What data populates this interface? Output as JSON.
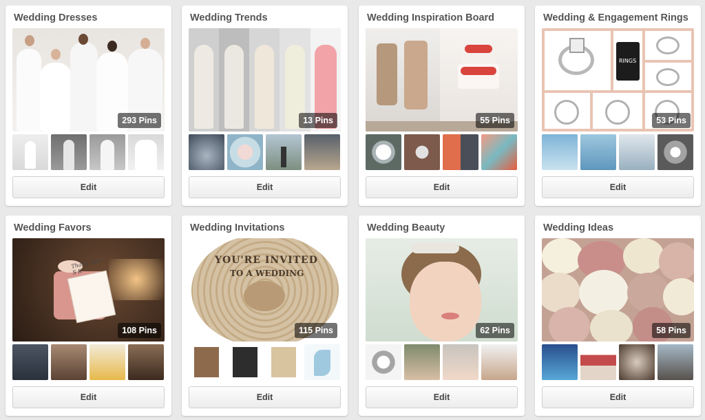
{
  "boards": [
    {
      "title": "Wedding Dresses",
      "pin_count": "293 Pins",
      "edit_label": "Edit"
    },
    {
      "title": "Wedding Trends",
      "pin_count": "13 Pins",
      "edit_label": "Edit"
    },
    {
      "title": "Wedding Inspiration Board",
      "pin_count": "55 Pins",
      "edit_label": "Edit"
    },
    {
      "title": "Wedding & Engagement Rings",
      "pin_count": "53 Pins",
      "edit_label": "Edit"
    },
    {
      "title": "Wedding Favors",
      "pin_count": "108 Pins",
      "edit_label": "Edit"
    },
    {
      "title": "Wedding Invitations",
      "pin_count": "115 Pins",
      "edit_label": "Edit"
    },
    {
      "title": "Wedding Beauty",
      "pin_count": "62 Pins",
      "edit_label": "Edit"
    },
    {
      "title": "Wedding Ideas",
      "pin_count": "58 Pins",
      "edit_label": "Edit"
    }
  ],
  "image_text": {
    "rings_tag": "RINGS",
    "favor_card": "Thank You! S K",
    "invite_line1": "YOU'RE INVITED",
    "invite_line2": "TO A WEDDING"
  }
}
